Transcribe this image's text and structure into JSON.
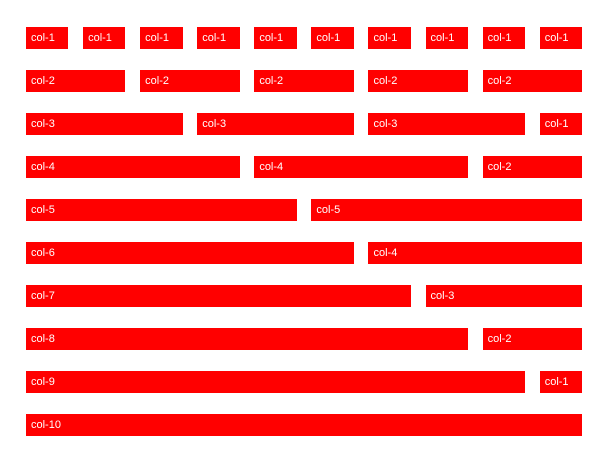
{
  "accent_color": "#ff0000",
  "text_color": "#ffffff",
  "rows": [
    {
      "cells": [
        {
          "label": "col-1",
          "span": 1
        },
        {
          "label": "col-1",
          "span": 1
        },
        {
          "label": "col-1",
          "span": 1
        },
        {
          "label": "col-1",
          "span": 1
        },
        {
          "label": "col-1",
          "span": 1
        },
        {
          "label": "col-1",
          "span": 1
        },
        {
          "label": "col-1",
          "span": 1
        },
        {
          "label": "col-1",
          "span": 1
        },
        {
          "label": "col-1",
          "span": 1
        },
        {
          "label": "col-1",
          "span": 1
        }
      ]
    },
    {
      "cells": [
        {
          "label": "col-2",
          "span": 2
        },
        {
          "label": "col-2",
          "span": 2
        },
        {
          "label": "col-2",
          "span": 2
        },
        {
          "label": "col-2",
          "span": 2
        },
        {
          "label": "col-2",
          "span": 2
        }
      ]
    },
    {
      "cells": [
        {
          "label": "col-3",
          "span": 3
        },
        {
          "label": "col-3",
          "span": 3
        },
        {
          "label": "col-3",
          "span": 3
        },
        {
          "label": "col-1",
          "span": 1
        }
      ]
    },
    {
      "cells": [
        {
          "label": "col-4",
          "span": 4
        },
        {
          "label": "col-4",
          "span": 4
        },
        {
          "label": "col-2",
          "span": 2
        }
      ]
    },
    {
      "cells": [
        {
          "label": "col-5",
          "span": 5
        },
        {
          "label": "col-5",
          "span": 5
        }
      ]
    },
    {
      "cells": [
        {
          "label": "col-6",
          "span": 6
        },
        {
          "label": "col-4",
          "span": 4
        }
      ]
    },
    {
      "cells": [
        {
          "label": "col-7",
          "span": 7
        },
        {
          "label": "col-3",
          "span": 3
        }
      ]
    },
    {
      "cells": [
        {
          "label": "col-8",
          "span": 8
        },
        {
          "label": "col-2",
          "span": 2
        }
      ]
    },
    {
      "cells": [
        {
          "label": "col-9",
          "span": 9
        },
        {
          "label": "col-1",
          "span": 1
        }
      ]
    },
    {
      "cells": [
        {
          "label": "col-10",
          "span": 10
        }
      ]
    }
  ]
}
